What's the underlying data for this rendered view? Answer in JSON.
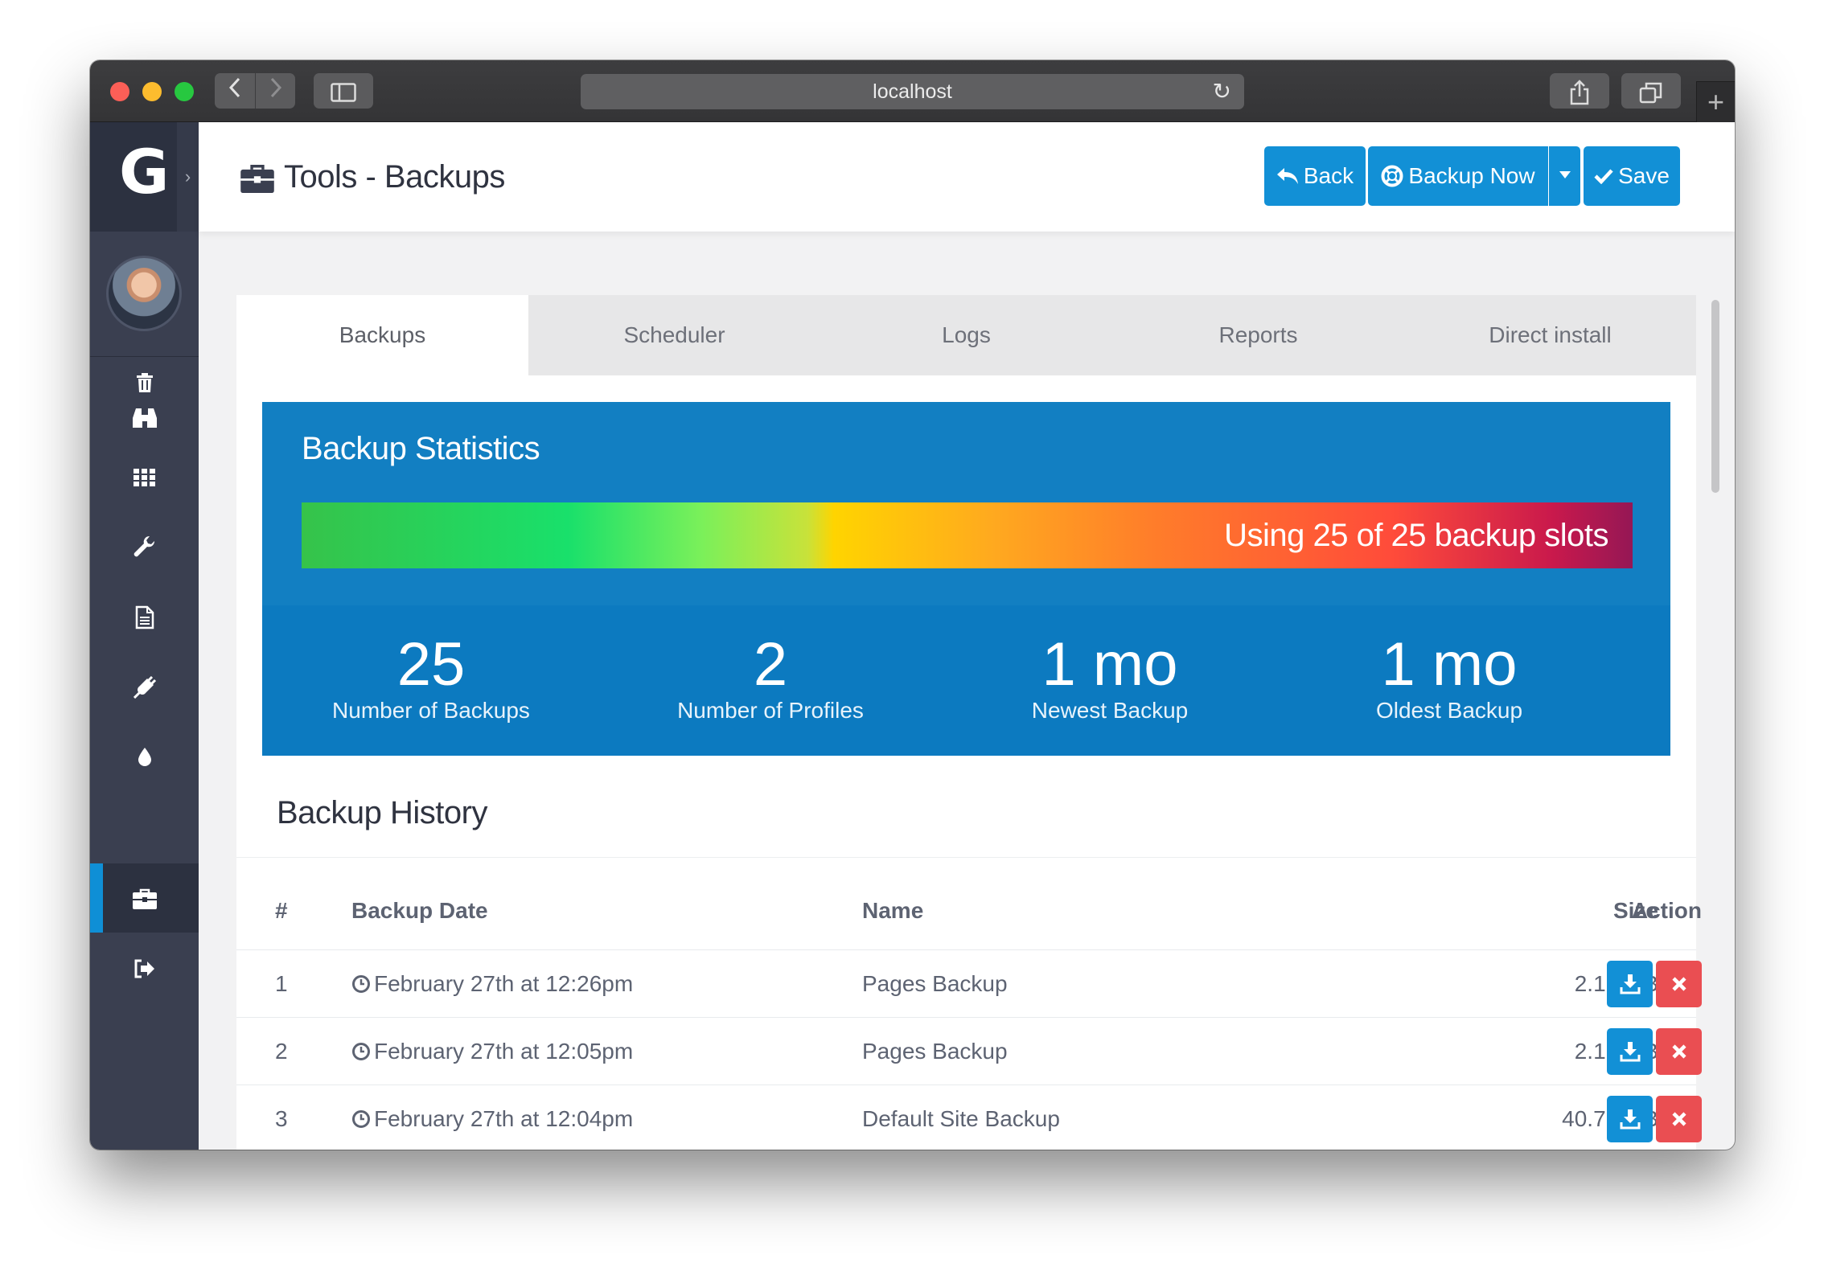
{
  "browser": {
    "url": "localhost"
  },
  "sidebar": {
    "logo_text": "G",
    "items": [
      {
        "icon": "trash-icon"
      },
      {
        "icon": "binoculars-icon"
      },
      {
        "icon": "grid-icon"
      },
      {
        "icon": "wrench-icon"
      },
      {
        "icon": "document-icon"
      },
      {
        "icon": "plug-icon"
      },
      {
        "icon": "droplet-icon"
      },
      {
        "icon": "briefcase-icon",
        "active": true
      },
      {
        "icon": "sign-out-icon"
      }
    ]
  },
  "header": {
    "title": "Tools - Backups",
    "back_label": "Back",
    "backup_now_label": "Backup Now",
    "save_label": "Save"
  },
  "tabs": [
    "Backups",
    "Scheduler",
    "Logs",
    "Reports",
    "Direct install"
  ],
  "active_tab": "Backups",
  "stats": {
    "title": "Backup Statistics",
    "slots_text": "Using 25 of 25 backup slots",
    "slots_used": 25,
    "slots_total": 25,
    "items": [
      {
        "value": "25",
        "label": "Number of Backups"
      },
      {
        "value": "2",
        "label": "Number of Profiles"
      },
      {
        "value": "1 mo",
        "label": "Newest Backup"
      },
      {
        "value": "1 mo",
        "label": "Oldest Backup"
      }
    ]
  },
  "history": {
    "title": "Backup History",
    "columns": {
      "num": "#",
      "date": "Backup Date",
      "name": "Name",
      "size": "Size",
      "action": "Action"
    },
    "rows": [
      {
        "num": "1",
        "date": "February 27th at 12:26pm",
        "name": "Pages Backup",
        "size": "2.16 MB"
      },
      {
        "num": "2",
        "date": "February 27th at 12:05pm",
        "name": "Pages Backup",
        "size": "2.16 MB"
      },
      {
        "num": "3",
        "date": "February 27th at 12:04pm",
        "name": "Default Site Backup",
        "size": "40.77 MB"
      }
    ]
  },
  "colors": {
    "primary": "#1290d6",
    "danger": "#ea4e52",
    "sidebar": "#3a3f50",
    "stats_panel": "#127fc2"
  }
}
